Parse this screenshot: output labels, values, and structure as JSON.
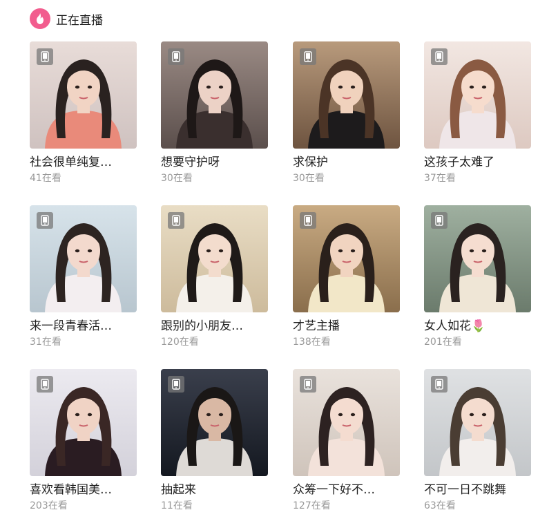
{
  "header": {
    "title": "正在直播",
    "icon": "flame-icon",
    "accent": "#f25d8e"
  },
  "cards": [
    {
      "title": "社会很单纯复…",
      "viewers": "41在看",
      "bg": [
        "#e8dcd8",
        "#cfc2c0"
      ],
      "shirt": "#e98a7a",
      "hair": "#2a2220",
      "skin": "#f1d4c4"
    },
    {
      "title": "想要守护呀",
      "viewers": "30在看",
      "bg": [
        "#9a8a84",
        "#5b4f4c"
      ],
      "shirt": "#3a2f2e",
      "hair": "#1e1817",
      "skin": "#ecd2c6"
    },
    {
      "title": "求保护",
      "viewers": "30在看",
      "bg": [
        "#b89a7c",
        "#6e5440"
      ],
      "shirt": "#1d1b1c",
      "hair": "#4b3426",
      "skin": "#f0d2bd"
    },
    {
      "title": "这孩子太难了",
      "viewers": "37在看",
      "bg": [
        "#f2e7e2",
        "#ddc9c1"
      ],
      "shirt": "#efe6e8",
      "hair": "#8a5a42",
      "skin": "#f6dccd"
    },
    {
      "title": "来一段青春活…",
      "viewers": "31在看",
      "bg": [
        "#d7e3ea",
        "#b8c6cf"
      ],
      "shirt": "#f3eef0",
      "hair": "#2d2421",
      "skin": "#f3d9cd"
    },
    {
      "title": "跟别的小朋友…",
      "viewers": "120在看",
      "bg": [
        "#e9ddc5",
        "#cdbb9c"
      ],
      "shirt": "#f4f0ea",
      "hair": "#1f1a18",
      "skin": "#f3dccd"
    },
    {
      "title": "才艺主播",
      "viewers": "138在看",
      "bg": [
        "#c9ab83",
        "#8a6e4c"
      ],
      "shirt": "#f2e7c8",
      "hair": "#2a201b",
      "skin": "#f1d4c0"
    },
    {
      "title": "女人如花🌷",
      "viewers": "201在看",
      "bg": [
        "#9fb0a0",
        "#6b7b6c"
      ],
      "shirt": "#efe6d6",
      "hair": "#2a2220",
      "skin": "#f5ddd0"
    },
    {
      "title": "喜欢看韩国美…",
      "viewers": "203在看",
      "bg": [
        "#eceaf0",
        "#d3d1da"
      ],
      "shirt": "#2a1c22",
      "hair": "#3a2725",
      "skin": "#f0d3c5"
    },
    {
      "title": "抽起来",
      "viewers": "11在看",
      "bg": [
        "#3a3f4c",
        "#141820"
      ],
      "shirt": "#dedad6",
      "hair": "#1a1716",
      "skin": "#d9b8a4"
    },
    {
      "title": "众筹一下好不…",
      "viewers": "127在看",
      "bg": [
        "#e9e2dc",
        "#cfc4bb"
      ],
      "shirt": "#f3e2da",
      "hair": "#2d2221",
      "skin": "#f4dcd0"
    },
    {
      "title": "不可一日不跳舞",
      "viewers": "63在看",
      "bg": [
        "#dfe1e3",
        "#c3c6c9"
      ],
      "shirt": "#f2eeec",
      "hair": "#4a3d33",
      "skin": "#f4dccf"
    }
  ]
}
